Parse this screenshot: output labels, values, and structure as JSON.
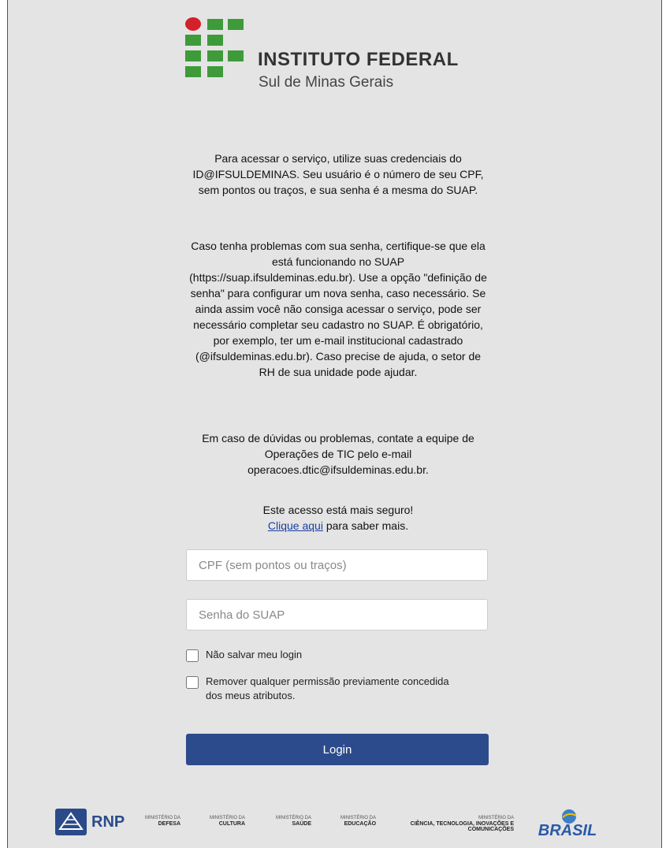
{
  "logo": {
    "title": "INSTITUTO FEDERAL",
    "subtitle": "Sul de Minas Gerais"
  },
  "instructions": {
    "p1": "Para acessar o serviço, utilize suas credenciais do ID@IFSULDEMINAS. Seu usuário é o número de seu CPF, sem pontos ou traços, e sua senha é a mesma do SUAP.",
    "p2": "Caso tenha problemas com sua senha, certifique-se que ela está funcionando no SUAP (https://suap.ifsuldeminas.edu.br). Use a opção \"definição de senha\" para configurar um nova senha, caso necessário. Se ainda assim você não consiga acessar o serviço, pode ser necessário completar seu cadastro no SUAP. É obrigatório, por exemplo, ter um e-mail institucional cadastrado (@ifsuldeminas.edu.br). Caso precise de ajuda, o setor de RH de sua unidade pode ajudar.",
    "p3": "Em caso de dúvidas ou problemas, contate a equipe de Operações de TIC pelo e-mail operacoes.dtic@ifsuldeminas.edu.br.",
    "secure_line": "Este acesso está mais seguro!",
    "link_text": "Clique aqui",
    "link_suffix": " para saber mais."
  },
  "form": {
    "username_placeholder": "CPF (sem pontos ou traços)",
    "password_placeholder": "Senha do SUAP",
    "checkbox_no_save": "Não salvar meu login",
    "checkbox_remove_consent": "Remover qualquer permissão previamente concedida dos meus atributos.",
    "login_label": "Login"
  },
  "footer": {
    "rnp": "RNP",
    "ministries": [
      {
        "top": "MINISTÉRIO DA",
        "name": "DEFESA"
      },
      {
        "top": "MINISTÉRIO DA",
        "name": "CULTURA"
      },
      {
        "top": "MINISTÉRIO DA",
        "name": "SAÚDE"
      },
      {
        "top": "MINISTÉRIO DA",
        "name": "EDUCAÇÃO"
      },
      {
        "top": "MINISTÉRIO DA",
        "name": "CIÊNCIA, TECNOLOGIA, INOVAÇÕES E COMUNICAÇÕES"
      }
    ],
    "brasil": "BRASIL"
  },
  "colors": {
    "background": "#e4e4e4",
    "logo_green": "#3f9a3a",
    "logo_red": "#d3202a",
    "button": "#2c4b8c",
    "link": "#1a3fa0"
  }
}
